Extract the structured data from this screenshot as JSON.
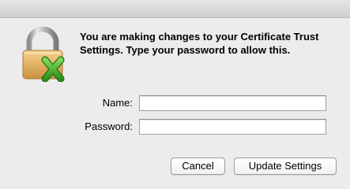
{
  "dialog": {
    "message": "You are making changes to your Certificate Trust Settings. Type your password to allow this.",
    "icon": "lock-with-x-icon"
  },
  "form": {
    "name_label": "Name:",
    "name_value": "",
    "password_label": "Password:",
    "password_value": ""
  },
  "buttons": {
    "cancel_label": "Cancel",
    "update_label": "Update Settings"
  },
  "colors": {
    "window_bg": "#ececec",
    "lock_body": "#e3b56a",
    "shackle": "#b5b5b5",
    "badge_green": "#3fae2a"
  }
}
